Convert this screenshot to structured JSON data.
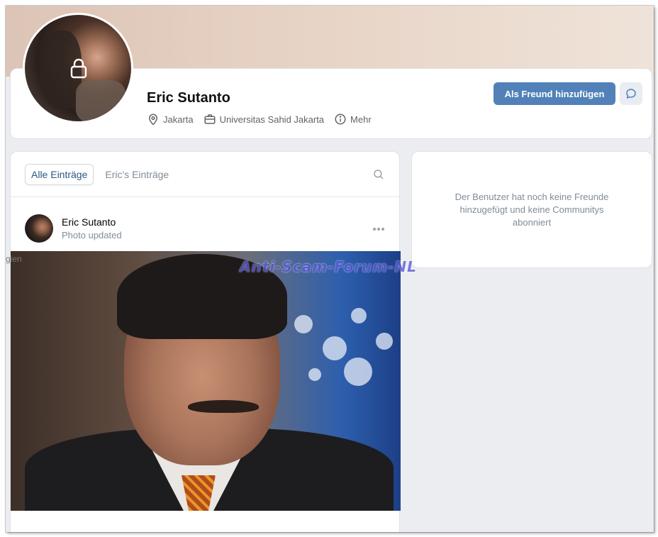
{
  "profile": {
    "name": "Eric Sutanto",
    "location": "Jakarta",
    "education": "Universitas Sahid Jakarta",
    "more_label": "Mehr"
  },
  "actions": {
    "add_friend_label": "Als Freund hinzufügen"
  },
  "feed": {
    "tabs": [
      {
        "label": "Alle Einträge",
        "active": true
      },
      {
        "label": "Eric's Einträge",
        "active": false
      }
    ],
    "post": {
      "author": "Eric Sutanto",
      "subtitle": "Photo updated"
    }
  },
  "sidebar": {
    "empty_text": "Der Benutzer hat noch keine Freunde hinzugefügt und keine Communitys abonniert"
  },
  "watermark": "Anti-Scam-Forum-NL",
  "edge_fragment": "gien",
  "colors": {
    "primary_button": "#5181b8",
    "active_tab_text": "#2a5885",
    "muted_text": "#818c99",
    "page_bg": "#ebedf0"
  }
}
